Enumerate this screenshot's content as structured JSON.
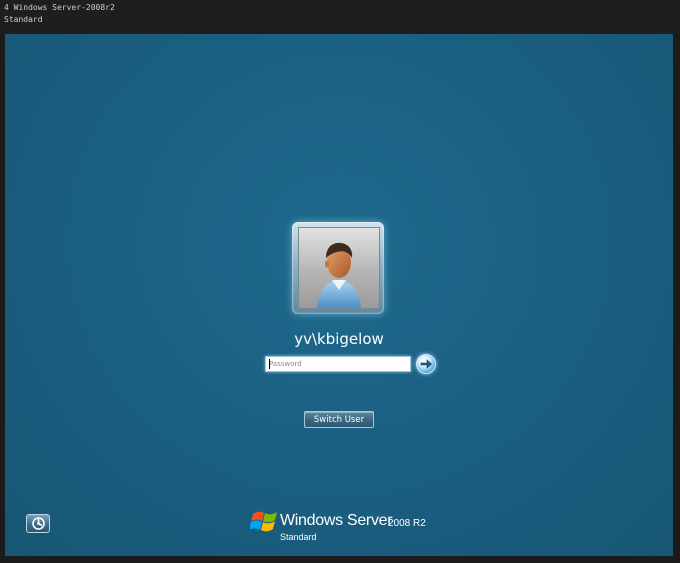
{
  "window": {
    "title_line1": "4 Windows Server-2008r2",
    "title_line2": "Standard"
  },
  "login": {
    "username": "yv\\kbigelow",
    "password_placeholder": "Password",
    "password_value": "",
    "switch_user_label": "Switch User"
  },
  "branding": {
    "product_name": "Windows Server",
    "version": "2008 R2",
    "edition": "Standard"
  },
  "icons": {
    "user_picture": "user-avatar-icon",
    "submit": "arrow-right-icon",
    "ease_of_access": "ease-of-access-icon",
    "logo": "windows-flag-icon"
  },
  "colors": {
    "background": "#1a5e80",
    "top_strip": "#1e1e1e",
    "button": "#3b6782"
  }
}
